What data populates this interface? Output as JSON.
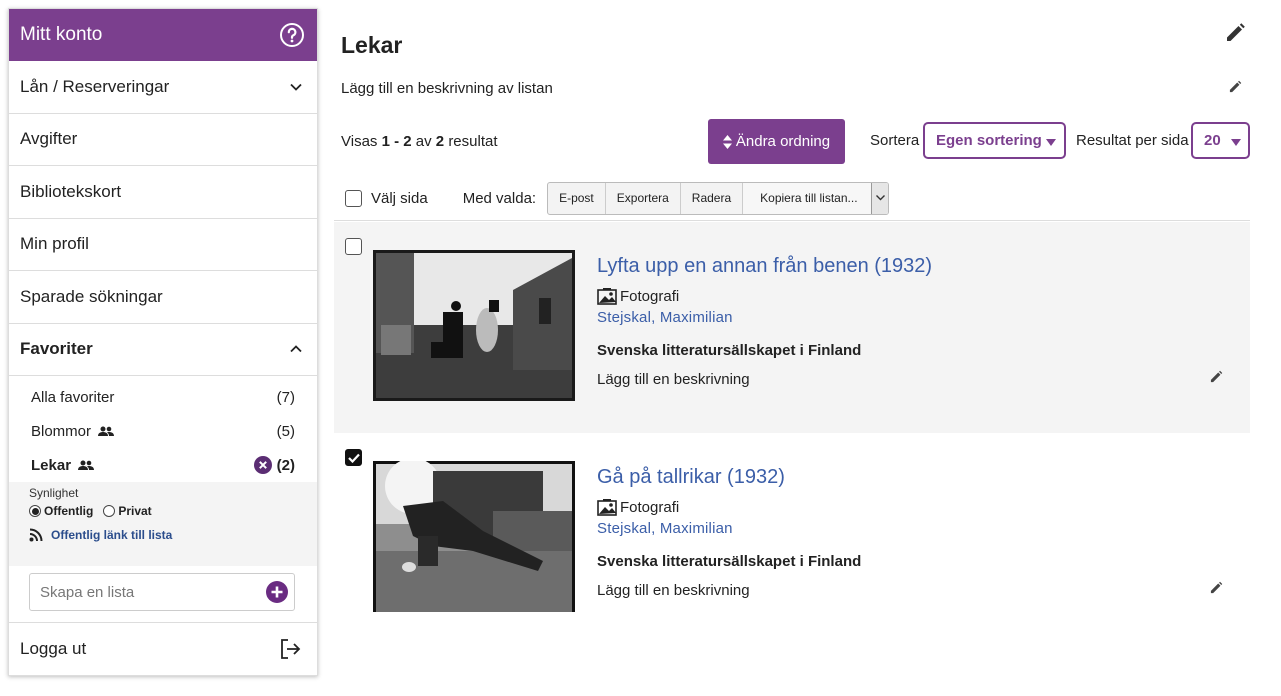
{
  "sidebar": {
    "header": "Mitt konto",
    "items": [
      {
        "label": "Lån / Reserveringar"
      },
      {
        "label": "Avgifter"
      },
      {
        "label": "Bibliotekskort"
      },
      {
        "label": "Min profil"
      },
      {
        "label": "Sparade sökningar"
      }
    ],
    "favorites": {
      "label": "Favoriter",
      "lists": [
        {
          "name": "Alla favoriter",
          "count": "(7)"
        },
        {
          "name": "Blommor",
          "count": "(5)"
        },
        {
          "name": "Lekar",
          "count": "(2)"
        }
      ],
      "visibility": {
        "title": "Synlighet",
        "public": "Offentlig",
        "private": "Privat",
        "public_link": "Offentlig länk till lista"
      },
      "create_placeholder": "Skapa en lista"
    },
    "logout": "Logga ut"
  },
  "main": {
    "title": "Lekar",
    "add_description": "Lägg till en beskrivning av listan",
    "showing": {
      "prefix": "Visas",
      "range": "1 - 2",
      "of": "av",
      "total": "2",
      "suffix": "resultat"
    },
    "reorder_button": "Ändra ordning",
    "sort_label": "Sortera",
    "sort_value": "Egen sortering",
    "rpp_label": "Resultat per sida",
    "rpp_value": "20",
    "bulk": {
      "select_page": "Välj sida",
      "with_selected": "Med valda:",
      "email": "E-post",
      "export": "Exportera",
      "delete": "Radera",
      "copy": "Kopiera till listan..."
    },
    "records": [
      {
        "title": "Lyfta upp en annan från benen (1932)",
        "format": "Fotografi",
        "author": "Stejskal, Maximilian",
        "org": "Svenska litteratursällskapet i Finland",
        "add_desc": "Lägg till en beskrivning",
        "checked": false
      },
      {
        "title": "Gå på tallrikar (1932)",
        "format": "Fotografi",
        "author": "Stejskal, Maximilian",
        "org": "Svenska litteratursällskapet i Finland",
        "add_desc": "Lägg till en beskrivning",
        "checked": true
      }
    ]
  },
  "colors": {
    "accent": "#7b3f8e",
    "link": "#3b5ea8"
  }
}
